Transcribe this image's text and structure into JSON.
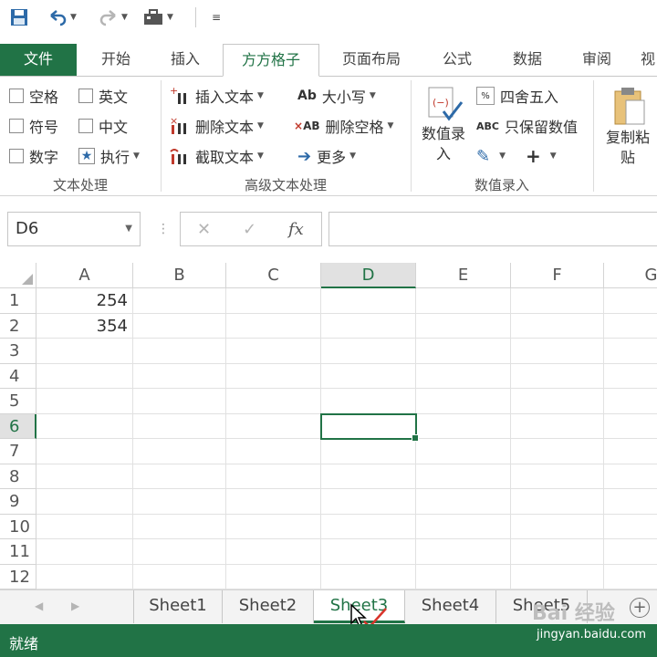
{
  "tabs": {
    "file": "文件",
    "items": [
      "开始",
      "插入",
      "方方格子",
      "页面布局",
      "公式",
      "数据",
      "审阅",
      "视"
    ],
    "active_index": 2
  },
  "ribbon": {
    "text_processing": {
      "checks": [
        "空格",
        "英文",
        "符号",
        "中文",
        "数字"
      ],
      "execute": "执行",
      "label": "文本处理"
    },
    "advanced_text": {
      "insert_text": "插入文本",
      "delete_text": "删除文本",
      "extract_text": "截取文本",
      "case": "大小写",
      "delete_spaces": "删除空格",
      "more": "更多",
      "label": "高级文本处理"
    },
    "number_entry": {
      "number_entry_btn": "数值录入",
      "round": "四舍五入",
      "keep_values": "只保留数值",
      "label": "数值录入"
    },
    "copy_paste": "复制粘贴"
  },
  "formula_bar": {
    "name_box": "D6",
    "fx": "fx",
    "value": ""
  },
  "grid": {
    "columns": [
      "A",
      "B",
      "C",
      "D",
      "E",
      "F",
      "G"
    ],
    "rows": [
      "1",
      "2",
      "3",
      "4",
      "5",
      "6",
      "7",
      "8",
      "9",
      "10",
      "11",
      "12"
    ],
    "selected_cell": "D6",
    "cells": {
      "A1": "254",
      "A2": "354"
    }
  },
  "sheets": {
    "items": [
      "Sheet1",
      "Sheet2",
      "Sheet3",
      "Sheet4",
      "Sheet5"
    ],
    "active": "Sheet3"
  },
  "status": {
    "ready": "就绪",
    "watermark": "Bai 经验",
    "url": "jingyan.baidu.com"
  },
  "colors": {
    "accent": "#217346"
  }
}
